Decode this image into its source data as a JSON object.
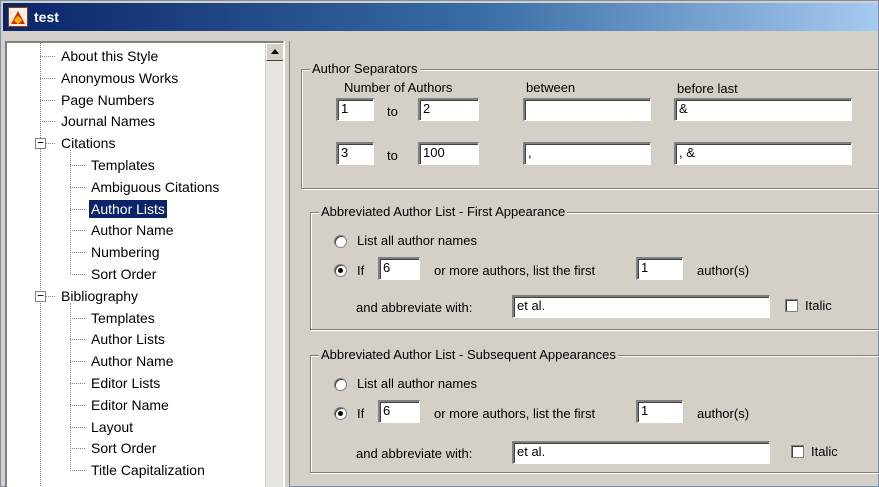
{
  "window": {
    "title": "test"
  },
  "tree": {
    "items": [
      {
        "label": "About this Style"
      },
      {
        "label": "Anonymous Works"
      },
      {
        "label": "Page Numbers"
      },
      {
        "label": "Journal Names"
      },
      {
        "label": "Citations",
        "expander": "−"
      },
      {
        "label": "Templates"
      },
      {
        "label": "Ambiguous Citations"
      },
      {
        "label": "Author Lists",
        "selected": true
      },
      {
        "label": "Author Name"
      },
      {
        "label": "Numbering"
      },
      {
        "label": "Sort Order"
      },
      {
        "label": "Bibliography",
        "expander": "−"
      },
      {
        "label": "Templates"
      },
      {
        "label": "Author Lists"
      },
      {
        "label": "Author Name"
      },
      {
        "label": "Editor Lists"
      },
      {
        "label": "Editor Name"
      },
      {
        "label": "Layout"
      },
      {
        "label": "Sort Order"
      },
      {
        "label": "Title Capitalization"
      }
    ]
  },
  "separators": {
    "title": "Author Separators",
    "num_authors_label": "Number of Authors",
    "between_label": "between",
    "before_last_label": "before last",
    "to_label": "to",
    "rows": [
      {
        "from": "1",
        "to": "2",
        "between": "",
        "before_last": "&"
      },
      {
        "from": "3",
        "to": "100",
        "between": ",",
        "before_last": ", &"
      }
    ]
  },
  "first_appearance": {
    "title": "Abbreviated Author List - First Appearance",
    "list_all_label": "List all author names",
    "if_label": "If",
    "threshold": "6",
    "middle_label": "or more authors, list the first",
    "first_n": "1",
    "authors_label": "author(s)",
    "abbrev_label": "and abbreviate with:",
    "abbrev_value": "et al.",
    "italic_label": "Italic"
  },
  "subsequent": {
    "title": "Abbreviated Author List - Subsequent Appearances",
    "list_all_label": "List all author names",
    "if_label": "If",
    "threshold": "6",
    "middle_label": "or more authors, list the first",
    "first_n": "1",
    "authors_label": "author(s)",
    "abbrev_label": "and abbreviate with:",
    "abbrev_value": "et al.",
    "italic_label": "Italic"
  }
}
